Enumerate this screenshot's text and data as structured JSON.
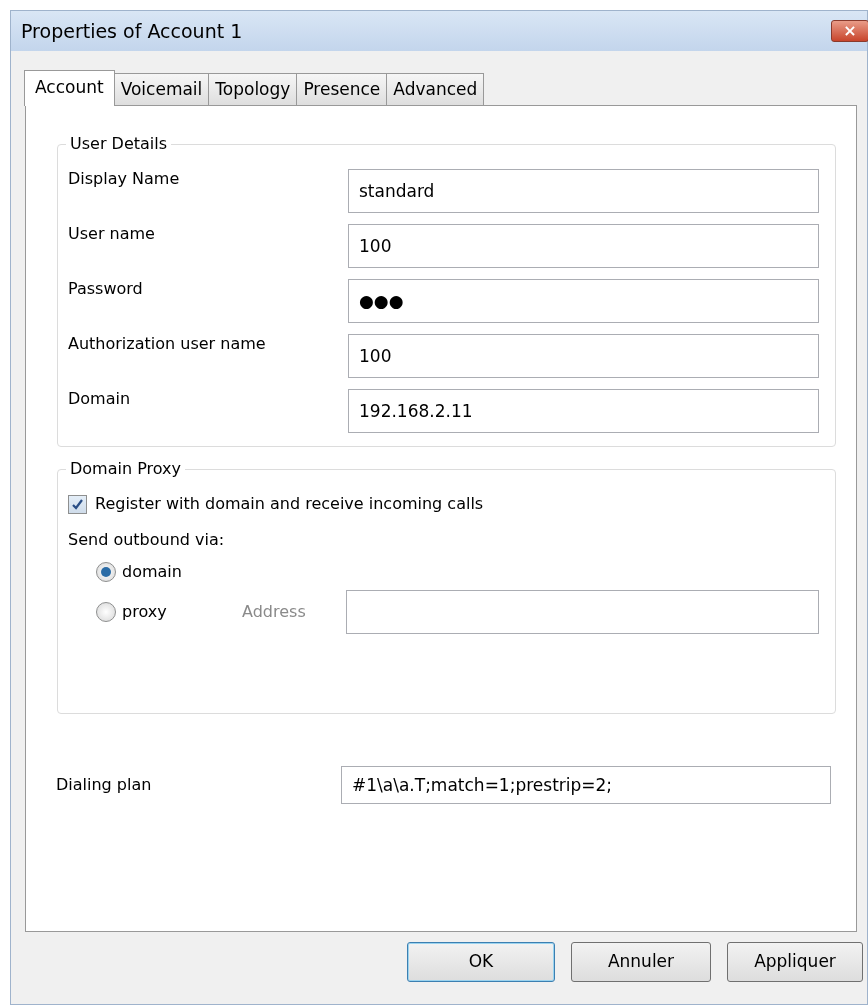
{
  "window": {
    "title": "Properties of Account 1",
    "close": "×"
  },
  "tabs": [
    {
      "label": "Account",
      "selected": true
    },
    {
      "label": "Voicemail",
      "selected": false
    },
    {
      "label": "Topology",
      "selected": false
    },
    {
      "label": "Presence",
      "selected": false
    },
    {
      "label": "Advanced",
      "selected": false
    }
  ],
  "user_details": {
    "title": "User Details",
    "fields": [
      {
        "label": "Display Name",
        "value": "standard"
      },
      {
        "label": "User name",
        "value": "100"
      },
      {
        "label": "Password",
        "value": "●●●"
      },
      {
        "label": "Authorization user name",
        "value": "100"
      },
      {
        "label": "Domain",
        "value": "192.168.2.11"
      }
    ]
  },
  "domain_proxy": {
    "title": "Domain Proxy",
    "register": {
      "label": "Register with domain and receive incoming calls",
      "checked": true
    },
    "send_label": "Send outbound via:",
    "options": [
      {
        "label": "domain",
        "selected": true
      },
      {
        "label": "proxy",
        "selected": false
      }
    ],
    "address": {
      "label": "Address",
      "disabled": true
    }
  },
  "dialing_plan": {
    "label": "Dialing plan",
    "value": "#1\\a\\a.T;match=1;prestrip=2;"
  },
  "buttons": [
    {
      "label": "OK",
      "default": true
    },
    {
      "label": "Annuler",
      "default": false
    },
    {
      "label": "Appliquer",
      "default": false
    }
  ]
}
